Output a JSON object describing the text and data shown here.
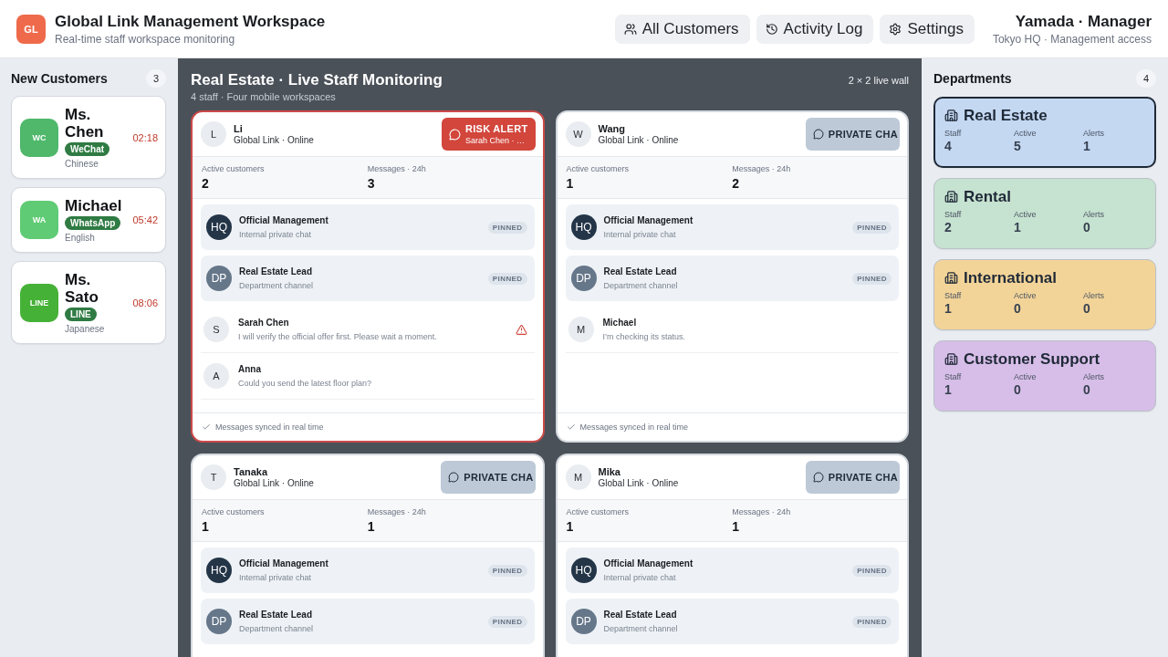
{
  "header": {
    "logo": "GL",
    "title": "Global Link Management Workspace",
    "subtitle": "Real-time staff workspace monitoring",
    "nav": [
      {
        "label": "All Customers"
      },
      {
        "label": "Activity Log"
      },
      {
        "label": "Settings"
      }
    ],
    "user": {
      "name": "Yamada · Manager",
      "detail": "Tokyo HQ · Management access"
    }
  },
  "new_customers": {
    "title": "New Customers",
    "count": "3",
    "items": [
      {
        "initials": "WC",
        "color": "#4fb86b",
        "name": "Ms. Chen",
        "channel": "WeChat",
        "language": "Chinese",
        "time": "02:18"
      },
      {
        "initials": "WA",
        "color": "#5fcb74",
        "name": "Michael",
        "channel": "WhatsApp",
        "language": "English",
        "time": "05:42"
      },
      {
        "initials": "LINE",
        "color": "#46b137",
        "name": "Ms. Sato",
        "channel": "LINE",
        "language": "Japanese",
        "time": "08:06"
      }
    ]
  },
  "monitor": {
    "title": "Real Estate · Live Staff Monitoring",
    "subtitle": "4 staff · Four mobile workspaces",
    "layout_label": "2 × 2 live wall",
    "workspaces": [
      {
        "initial": "L",
        "name": "Li",
        "status": "Global Link · Online",
        "alert": true,
        "action": {
          "kind": "risk_alert",
          "label": "RISK ALERT",
          "detail": "Sarah Chen · …"
        },
        "stats": [
          {
            "label": "Active customers",
            "value": "2"
          },
          {
            "label": "Messages · 24h",
            "value": "3"
          }
        ],
        "conversations": [
          {
            "kind": "pinned",
            "initials": "HQ",
            "color": "#243548",
            "title": "Official Management",
            "subtitle": "Internal private chat",
            "badge": "PINNED"
          },
          {
            "kind": "pinned",
            "initials": "DP",
            "color": "#66778a",
            "title": "Real Estate Lead",
            "subtitle": "Department channel",
            "badge": "PINNED"
          },
          {
            "kind": "chat",
            "initial": "S",
            "name": "Sarah Chen",
            "message": "I will verify the official offer first. Please wait a moment.",
            "flagged": true
          },
          {
            "kind": "chat",
            "initial": "A",
            "name": "Anna",
            "message": "Could you send the latest floor plan?",
            "flagged": false
          }
        ],
        "footer": "Messages synced in real time"
      },
      {
        "initial": "W",
        "name": "Wang",
        "status": "Global Link · Online",
        "alert": false,
        "action": {
          "kind": "private_chat",
          "label": "PRIVATE CHA"
        },
        "stats": [
          {
            "label": "Active customers",
            "value": "1"
          },
          {
            "label": "Messages · 24h",
            "value": "2"
          }
        ],
        "conversations": [
          {
            "kind": "pinned",
            "initials": "HQ",
            "color": "#243548",
            "title": "Official Management",
            "subtitle": "Internal private chat",
            "badge": "PINNED"
          },
          {
            "kind": "pinned",
            "initials": "DP",
            "color": "#66778a",
            "title": "Real Estate Lead",
            "subtitle": "Department channel",
            "badge": "PINNED"
          },
          {
            "kind": "chat",
            "initial": "M",
            "name": "Michael",
            "message": "I’m checking its status.",
            "flagged": false
          }
        ],
        "footer": "Messages synced in real time"
      },
      {
        "initial": "T",
        "name": "Tanaka",
        "status": "Global Link · Online",
        "alert": false,
        "action": {
          "kind": "private_chat",
          "label": "PRIVATE CHA"
        },
        "stats": [
          {
            "label": "Active customers",
            "value": "1"
          },
          {
            "label": "Messages · 24h",
            "value": "1"
          }
        ],
        "conversations": [
          {
            "kind": "pinned",
            "initials": "HQ",
            "color": "#243548",
            "title": "Official Management",
            "subtitle": "Internal private chat",
            "badge": "PINNED"
          },
          {
            "kind": "pinned",
            "initials": "DP",
            "color": "#66778a",
            "title": "Real Estate Lead",
            "subtitle": "Department channel",
            "badge": "PINNED"
          }
        ]
      },
      {
        "initial": "M",
        "name": "Mika",
        "status": "Global Link · Online",
        "alert": false,
        "action": {
          "kind": "private_chat",
          "label": "PRIVATE CHA"
        },
        "stats": [
          {
            "label": "Active customers",
            "value": "1"
          },
          {
            "label": "Messages · 24h",
            "value": "1"
          }
        ],
        "conversations": [
          {
            "kind": "pinned",
            "initials": "HQ",
            "color": "#243548",
            "title": "Official Management",
            "subtitle": "Internal private chat",
            "badge": "PINNED"
          },
          {
            "kind": "pinned",
            "initials": "DP",
            "color": "#66778a",
            "title": "Real Estate Lead",
            "subtitle": "Department channel",
            "badge": "PINNED"
          }
        ]
      }
    ]
  },
  "departments": {
    "title": "Departments",
    "count": "4",
    "items": [
      {
        "name": "Real Estate",
        "color": "#c4d8f2",
        "selected": true,
        "stats": [
          {
            "label": "Staff",
            "value": "4"
          },
          {
            "label": "Active",
            "value": "5"
          },
          {
            "label": "Alerts",
            "value": "1"
          }
        ]
      },
      {
        "name": "Rental",
        "color": "#c6e2d0",
        "selected": false,
        "stats": [
          {
            "label": "Staff",
            "value": "2"
          },
          {
            "label": "Active",
            "value": "1"
          },
          {
            "label": "Alerts",
            "value": "0"
          }
        ]
      },
      {
        "name": "International",
        "color": "#f3d498",
        "selected": false,
        "stats": [
          {
            "label": "Staff",
            "value": "1"
          },
          {
            "label": "Active",
            "value": "0"
          },
          {
            "label": "Alerts",
            "value": "0"
          }
        ]
      },
      {
        "name": "Customer Support",
        "color": "#d7bee8",
        "selected": false,
        "stats": [
          {
            "label": "Staff",
            "value": "1"
          },
          {
            "label": "Active",
            "value": "0"
          },
          {
            "label": "Alerts",
            "value": "0"
          }
        ]
      }
    ]
  }
}
